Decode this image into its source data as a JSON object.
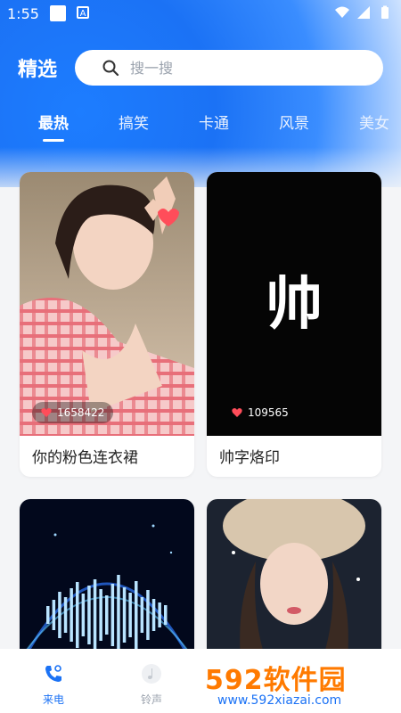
{
  "status": {
    "time": "1:55",
    "notif_letter": "A"
  },
  "header": {
    "title": "精选",
    "search_placeholder": "搜一搜"
  },
  "tabs": [
    {
      "label": "最热",
      "active": true
    },
    {
      "label": "搞笑"
    },
    {
      "label": "卡通"
    },
    {
      "label": "风景"
    },
    {
      "label": "美女"
    }
  ],
  "cards": [
    {
      "title": "你的粉色连衣裙",
      "likes": "1658422",
      "thumb": "photo-girl-pink"
    },
    {
      "title": "帅字烙印",
      "likes": "109565",
      "thumb": "calligraphy-shuai",
      "thumb_text": "帅"
    },
    {
      "title": "",
      "likes": "",
      "thumb": "audio-visualizer"
    },
    {
      "title": "",
      "likes": "",
      "thumb": "photo-girl-fur-hat"
    }
  ],
  "bottom_nav": [
    {
      "label": "来电",
      "icon": "phone-icon",
      "active": true
    },
    {
      "label": "铃声",
      "icon": "music-note-icon"
    }
  ],
  "watermark": {
    "big": "592软件园",
    "small": "www.592xiazai.com"
  },
  "colors": {
    "accent": "#1b72f5",
    "watermark_orange": "#ff7a00",
    "heart": "#ff4d5a"
  }
}
